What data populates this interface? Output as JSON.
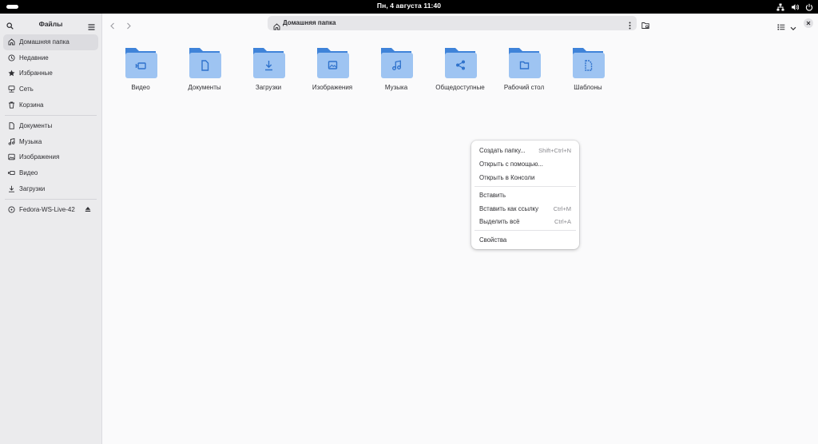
{
  "topbar": {
    "clock": "Пн, 4 августа  11:40",
    "tray_icons": [
      "network-icon",
      "volume-icon",
      "power-icon"
    ]
  },
  "sidebar": {
    "title": "Файлы",
    "places": [
      {
        "label": "Домашняя папка",
        "icon": "home-icon",
        "active": true
      },
      {
        "label": "Недавние",
        "icon": "clock-icon"
      },
      {
        "label": "Избранные",
        "icon": "star-icon"
      },
      {
        "label": "Сеть",
        "icon": "network-icon"
      },
      {
        "label": "Корзина",
        "icon": "trash-icon"
      }
    ],
    "bookmarks": [
      {
        "label": "Документы",
        "icon": "document-icon"
      },
      {
        "label": "Музыка",
        "icon": "music-icon"
      },
      {
        "label": "Изображения",
        "icon": "image-icon"
      },
      {
        "label": "Видео",
        "icon": "video-icon"
      },
      {
        "label": "Загрузки",
        "icon": "download-icon"
      }
    ],
    "devices": [
      {
        "label": "Fedora-WS-Live-42",
        "icon": "disc-icon",
        "eject_icon": "eject-icon"
      }
    ]
  },
  "header": {
    "path_label": "Домашняя папка"
  },
  "folders": [
    {
      "label": "Видео",
      "emblem": "video"
    },
    {
      "label": "Документы",
      "emblem": "document"
    },
    {
      "label": "Загрузки",
      "emblem": "download"
    },
    {
      "label": "Изображения",
      "emblem": "image"
    },
    {
      "label": "Музыка",
      "emblem": "music"
    },
    {
      "label": "Общедоступные",
      "emblem": "share"
    },
    {
      "label": "Рабочий стол",
      "emblem": "folder"
    },
    {
      "label": "Шаблоны",
      "emblem": "template"
    }
  ],
  "context_menu": {
    "groups": [
      [
        {
          "label": "Создать папку...",
          "accel": "Shift+Ctrl+N"
        },
        {
          "label": "Открыть с помощью...",
          "accel": ""
        },
        {
          "label": "Открыть в Консоли",
          "accel": ""
        }
      ],
      [
        {
          "label": "Вставить",
          "accel": ""
        },
        {
          "label": "Вставить как ссылку",
          "accel": "Ctrl+M"
        },
        {
          "label": "Выделить всё",
          "accel": "Ctrl+A"
        }
      ],
      [
        {
          "label": "Свойства",
          "accel": ""
        }
      ]
    ]
  },
  "colors": {
    "folder_back": "#3f83d9",
    "folder_front": "#9ec4f2",
    "emblem": "#2f72cc"
  }
}
